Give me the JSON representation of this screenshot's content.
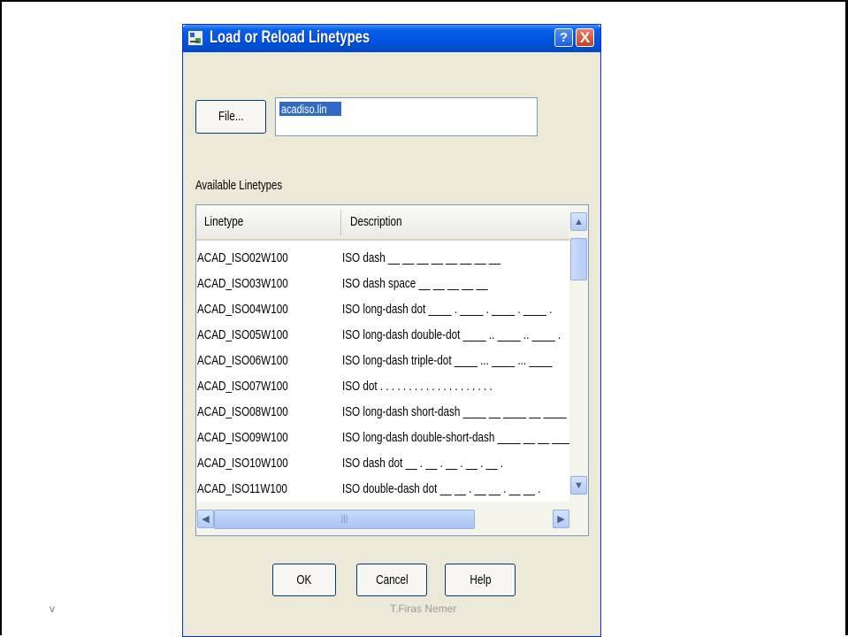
{
  "dialog": {
    "title": "Load or Reload Linetypes",
    "help_glyph": "?",
    "close_glyph": "X",
    "file_button": "File...",
    "file_value": "acadiso.lin",
    "available_label": "Available Linetypes",
    "columns": {
      "linetype": "Linetype",
      "description": "Description"
    },
    "rows": [
      {
        "name": "ACAD_ISO02W100",
        "desc": "ISO dash __ __ __ __ __ __ __ __"
      },
      {
        "name": "ACAD_ISO03W100",
        "desc": "ISO dash space __    __    __    __    __"
      },
      {
        "name": "ACAD_ISO04W100",
        "desc": "ISO long-dash dot ____ . ____ . ____ . ____ ."
      },
      {
        "name": "ACAD_ISO05W100",
        "desc": "ISO long-dash double-dot ____ .. ____ .. ____ ."
      },
      {
        "name": "ACAD_ISO06W100",
        "desc": "ISO long-dash triple-dot ____ ... ____ ... ____"
      },
      {
        "name": "ACAD_ISO07W100",
        "desc": "ISO dot . . . . . . . . . . . . . . . . . . . ."
      },
      {
        "name": "ACAD_ISO08W100",
        "desc": "ISO long-dash short-dash ____ __ ____ __ ____"
      },
      {
        "name": "ACAD_ISO09W100",
        "desc": "ISO long-dash double-short-dash ____ __ __ ____"
      },
      {
        "name": "ACAD_ISO10W100",
        "desc": "ISO dash dot __ . __ . __ . __ . __ ."
      },
      {
        "name": "ACAD_ISO11W100",
        "desc": "ISO double-dash dot __ __ . __ __ . __ __ ."
      }
    ],
    "buttons": {
      "ok": "OK",
      "cancel": "Cancel",
      "help": "Help"
    }
  },
  "footer": {
    "left_mark": "v",
    "author": "T.Firas Nemer"
  }
}
